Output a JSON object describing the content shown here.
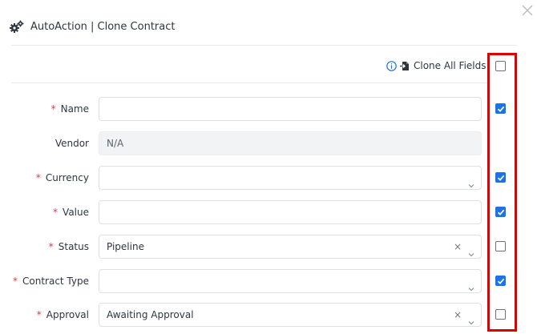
{
  "dialog": {
    "title": "AutoAction | Clone Contract",
    "clone_all_label": "Clone All Fields",
    "clone_all_checked": false
  },
  "fields": [
    {
      "label": "Name",
      "required": true,
      "value": "",
      "type": "text",
      "checked": true,
      "has_checkbox": true
    },
    {
      "label": "Vendor",
      "required": false,
      "value": "N/A",
      "type": "readonly",
      "has_checkbox": false
    },
    {
      "label": "Currency",
      "required": true,
      "value": "",
      "type": "select",
      "checked": true,
      "has_checkbox": true
    },
    {
      "label": "Value",
      "required": true,
      "value": "",
      "type": "text",
      "checked": true,
      "has_checkbox": true
    },
    {
      "label": "Status",
      "required": true,
      "value": "Pipeline",
      "type": "select-clearable",
      "checked": false,
      "has_checkbox": true
    },
    {
      "label": "Contract Type",
      "required": true,
      "value": "",
      "type": "select",
      "checked": true,
      "has_checkbox": true
    },
    {
      "label": "Approval",
      "required": true,
      "value": "Awaiting Approval",
      "type": "select-clearable",
      "checked": false,
      "has_checkbox": true
    }
  ],
  "glyphs": {
    "required_mark": "*",
    "clear": "×"
  },
  "colors": {
    "accent": "#1a73e8",
    "required": "#e0394b",
    "highlight": "#e00000"
  }
}
